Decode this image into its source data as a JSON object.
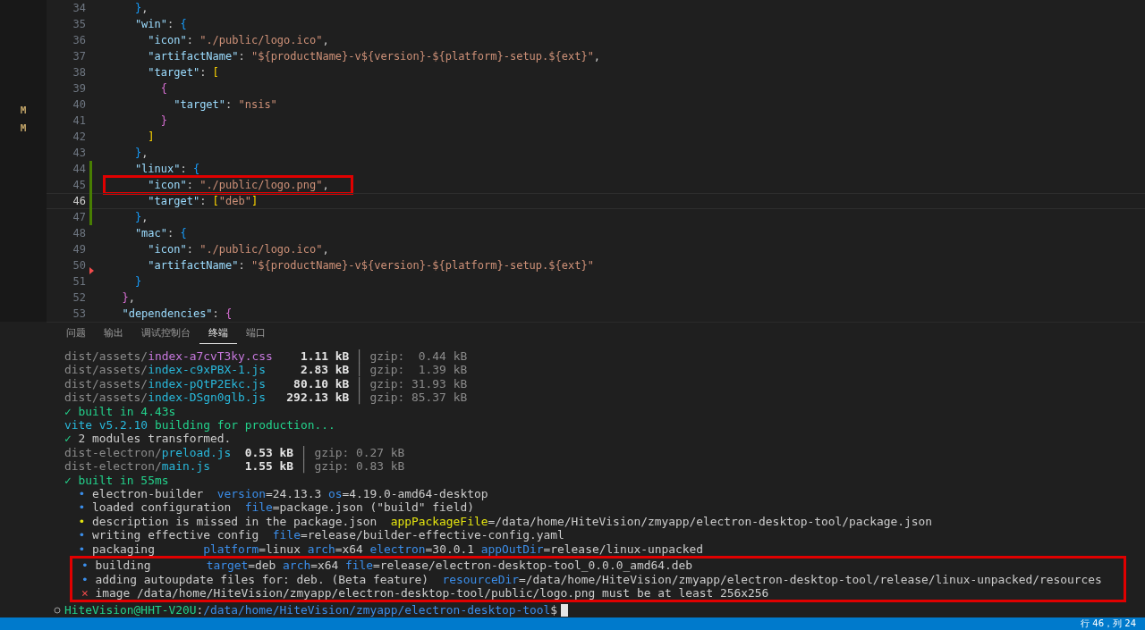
{
  "scm_markers": [
    "M",
    "M"
  ],
  "editor": {
    "lines": [
      {
        "number": "34",
        "tokens": [
          {
            "text": "    }",
            "kind": "b3"
          },
          {
            "text": ",",
            "kind": "p"
          }
        ]
      },
      {
        "number": "35",
        "tokens": [
          {
            "text": "    \"win\"",
            "kind": "key"
          },
          {
            "text": ": ",
            "kind": "p"
          },
          {
            "text": "{",
            "kind": "b3"
          }
        ]
      },
      {
        "number": "36",
        "tokens": [
          {
            "text": "      \"icon\"",
            "kind": "key"
          },
          {
            "text": ": ",
            "kind": "p"
          },
          {
            "text": "\"./public/logo.ico\"",
            "kind": "str"
          },
          {
            "text": ",",
            "kind": "p"
          }
        ]
      },
      {
        "number": "37",
        "tokens": [
          {
            "text": "      \"artifactName\"",
            "kind": "key"
          },
          {
            "text": ": ",
            "kind": "p"
          },
          {
            "text": "\"${productName}-v${version}-${platform}-setup.${ext}\"",
            "kind": "str"
          },
          {
            "text": ",",
            "kind": "p"
          }
        ]
      },
      {
        "number": "38",
        "tokens": [
          {
            "text": "      \"target\"",
            "kind": "key"
          },
          {
            "text": ": ",
            "kind": "p"
          },
          {
            "text": "[",
            "kind": "b1"
          }
        ]
      },
      {
        "number": "39",
        "tokens": [
          {
            "text": "        {",
            "kind": "b2"
          }
        ]
      },
      {
        "number": "40",
        "tokens": [
          {
            "text": "          \"target\"",
            "kind": "key"
          },
          {
            "text": ": ",
            "kind": "p"
          },
          {
            "text": "\"nsis\"",
            "kind": "str"
          }
        ]
      },
      {
        "number": "41",
        "tokens": [
          {
            "text": "        }",
            "kind": "b2"
          }
        ]
      },
      {
        "number": "42",
        "tokens": [
          {
            "text": "      ]",
            "kind": "b1"
          }
        ]
      },
      {
        "number": "43",
        "tokens": [
          {
            "text": "    }",
            "kind": "b3"
          },
          {
            "text": ",",
            "kind": "p"
          }
        ]
      },
      {
        "number": "44",
        "added": true,
        "tokens": [
          {
            "text": "    \"linux\"",
            "kind": "key"
          },
          {
            "text": ": ",
            "kind": "p"
          },
          {
            "text": "{",
            "kind": "b3"
          }
        ]
      },
      {
        "number": "45",
        "added": true,
        "boxed": true,
        "tokens": [
          {
            "text": "      \"icon\"",
            "kind": "key"
          },
          {
            "text": ": ",
            "kind": "p"
          },
          {
            "text": "\"./public/logo.png\"",
            "kind": "str"
          },
          {
            "text": ",",
            "kind": "p"
          }
        ]
      },
      {
        "number": "46",
        "added": true,
        "current": true,
        "tokens": [
          {
            "text": "      \"target\"",
            "kind": "key"
          },
          {
            "text": ": ",
            "kind": "p"
          },
          {
            "text": "[",
            "kind": "b1"
          },
          {
            "text": "\"deb\"",
            "kind": "str"
          },
          {
            "text": "]",
            "kind": "b1"
          }
        ]
      },
      {
        "number": "47",
        "added": true,
        "tokens": [
          {
            "text": "    }",
            "kind": "b3"
          },
          {
            "text": ",",
            "kind": "p"
          }
        ]
      },
      {
        "number": "48",
        "tokens": [
          {
            "text": "    \"mac\"",
            "kind": "key"
          },
          {
            "text": ": ",
            "kind": "p"
          },
          {
            "text": "{",
            "kind": "b3"
          }
        ]
      },
      {
        "number": "49",
        "tokens": [
          {
            "text": "      \"icon\"",
            "kind": "key"
          },
          {
            "text": ": ",
            "kind": "p"
          },
          {
            "text": "\"./public/logo.ico\"",
            "kind": "str"
          },
          {
            "text": ",",
            "kind": "p"
          }
        ]
      },
      {
        "number": "50",
        "deleted": true,
        "tokens": [
          {
            "text": "      \"artifactName\"",
            "kind": "key"
          },
          {
            "text": ": ",
            "kind": "p"
          },
          {
            "text": "\"${productName}-v${version}-${platform}-setup.${ext}\"",
            "kind": "str"
          }
        ]
      },
      {
        "number": "51",
        "tokens": [
          {
            "text": "    }",
            "kind": "b3"
          }
        ]
      },
      {
        "number": "52",
        "tokens": [
          {
            "text": "  }",
            "kind": "b2"
          },
          {
            "text": ",",
            "kind": "p"
          }
        ]
      },
      {
        "number": "53",
        "tokens": [
          {
            "text": "  \"dependencies\"",
            "kind": "key"
          },
          {
            "text": ": ",
            "kind": "p"
          },
          {
            "text": "{",
            "kind": "b2"
          }
        ]
      }
    ]
  },
  "panel": {
    "tabs": [
      {
        "label": "问题",
        "selected": false
      },
      {
        "label": "输出",
        "selected": false
      },
      {
        "label": "调试控制台",
        "selected": false
      },
      {
        "label": "终端",
        "selected": true
      },
      {
        "label": "端口",
        "selected": false
      }
    ],
    "terminal": [
      {
        "segs": [
          {
            "text": "dist/assets/",
            "kind": "dim"
          },
          {
            "text": "index-a7cvT3ky.css",
            "kind": "mag"
          },
          {
            "text": "    1.11 kB",
            "kind": "bold"
          },
          {
            "text": " │ ",
            "kind": "dim"
          },
          {
            "text": "gzip:  0.44 kB",
            "kind": "dim"
          }
        ]
      },
      {
        "segs": [
          {
            "text": "dist/assets/",
            "kind": "dim"
          },
          {
            "text": "index-c9xPBX-1.js",
            "kind": "cyan"
          },
          {
            "text": "     2.83 kB",
            "kind": "bold"
          },
          {
            "text": " │ ",
            "kind": "dim"
          },
          {
            "text": "gzip:  1.39 kB",
            "kind": "dim"
          }
        ]
      },
      {
        "segs": [
          {
            "text": "dist/assets/",
            "kind": "dim"
          },
          {
            "text": "index-pQtP2Ekc.js",
            "kind": "cyan"
          },
          {
            "text": "    80.10 kB",
            "kind": "bold"
          },
          {
            "text": " │ ",
            "kind": "dim"
          },
          {
            "text": "gzip: 31.93 kB",
            "kind": "dim"
          }
        ]
      },
      {
        "segs": [
          {
            "text": "dist/assets/",
            "kind": "dim"
          },
          {
            "text": "index-DSgn0glb.js",
            "kind": "cyan"
          },
          {
            "text": "   292.13 kB",
            "kind": "bold"
          },
          {
            "text": " │ ",
            "kind": "dim"
          },
          {
            "text": "gzip: 85.37 kB",
            "kind": "dim"
          }
        ]
      },
      {
        "segs": [
          {
            "text": "✓ built in 4.43s",
            "kind": "green"
          }
        ]
      },
      {
        "segs": [
          {
            "text": "vite v5.2.10 ",
            "kind": "cyan"
          },
          {
            "text": "building for production...",
            "kind": "green"
          }
        ]
      },
      {
        "segs": [
          {
            "text": "✓ ",
            "kind": "green"
          },
          {
            "text": "2 modules transformed.",
            "kind": "text"
          }
        ]
      },
      {
        "segs": [
          {
            "text": "dist-electron/",
            "kind": "dim"
          },
          {
            "text": "preload.js",
            "kind": "cyan"
          },
          {
            "text": "  0.53 kB",
            "kind": "bold"
          },
          {
            "text": " │ ",
            "kind": "dim"
          },
          {
            "text": "gzip: 0.27 kB",
            "kind": "dim"
          }
        ]
      },
      {
        "segs": [
          {
            "text": "dist-electron/",
            "kind": "dim"
          },
          {
            "text": "main.js",
            "kind": "cyan"
          },
          {
            "text": "     1.55 kB",
            "kind": "bold"
          },
          {
            "text": " │ ",
            "kind": "dim"
          },
          {
            "text": "gzip: 0.83 kB",
            "kind": "dim"
          }
        ]
      },
      {
        "segs": [
          {
            "text": "✓ built in 55ms",
            "kind": "green"
          }
        ]
      },
      {
        "segs": [
          {
            "text": "  • ",
            "kind": "blue"
          },
          {
            "text": "electron-builder  ",
            "kind": "text"
          },
          {
            "text": "version",
            "kind": "blue"
          },
          {
            "text": "=24.13.3 ",
            "kind": "text"
          },
          {
            "text": "os",
            "kind": "blue"
          },
          {
            "text": "=4.19.0-amd64-desktop",
            "kind": "text"
          }
        ]
      },
      {
        "segs": [
          {
            "text": "  • ",
            "kind": "blue"
          },
          {
            "text": "loaded configuration  ",
            "kind": "text"
          },
          {
            "text": "file",
            "kind": "blue"
          },
          {
            "text": "=package.json (\"build\" field)",
            "kind": "text"
          }
        ]
      },
      {
        "segs": [
          {
            "text": "  • ",
            "kind": "yellow"
          },
          {
            "text": "description is missed in the package.json  ",
            "kind": "text"
          },
          {
            "text": "appPackageFile",
            "kind": "yellow"
          },
          {
            "text": "=/data/home/HiteVision/zmyapp/electron-desktop-tool/package.json",
            "kind": "text"
          }
        ]
      },
      {
        "segs": [
          {
            "text": "  • ",
            "kind": "blue"
          },
          {
            "text": "writing effective config  ",
            "kind": "text"
          },
          {
            "text": "file",
            "kind": "blue"
          },
          {
            "text": "=release/builder-effective-config.yaml",
            "kind": "text"
          }
        ]
      },
      {
        "segs": [
          {
            "text": "  • ",
            "kind": "blue"
          },
          {
            "text": "packaging       ",
            "kind": "text"
          },
          {
            "text": "platform",
            "kind": "blue"
          },
          {
            "text": "=linux ",
            "kind": "text"
          },
          {
            "text": "arch",
            "kind": "blue"
          },
          {
            "text": "=x64 ",
            "kind": "text"
          },
          {
            "text": "electron",
            "kind": "blue"
          },
          {
            "text": "=30.0.1 ",
            "kind": "text"
          },
          {
            "text": "appOutDir",
            "kind": "blue"
          },
          {
            "text": "=release/linux-unpacked",
            "kind": "text"
          }
        ]
      },
      {
        "boxed": true,
        "segs": [
          {
            "text": "• ",
            "kind": "blue"
          },
          {
            "text": "building        ",
            "kind": "text"
          },
          {
            "text": "target",
            "kind": "blue"
          },
          {
            "text": "=deb ",
            "kind": "text"
          },
          {
            "text": "arch",
            "kind": "blue"
          },
          {
            "text": "=x64 ",
            "kind": "text"
          },
          {
            "text": "file",
            "kind": "blue"
          },
          {
            "text": "=release/electron-desktop-tool_0.0.0_amd64.deb",
            "kind": "text"
          }
        ]
      },
      {
        "boxed": true,
        "segs": [
          {
            "text": "• ",
            "kind": "blue"
          },
          {
            "text": "adding autoupdate files for: deb. (Beta feature)  ",
            "kind": "text"
          },
          {
            "text": "resourceDir",
            "kind": "blue"
          },
          {
            "text": "=/data/home/HiteVision/zmyapp/electron-desktop-tool/release/linux-unpacked/resources",
            "kind": "text"
          }
        ]
      },
      {
        "boxed": true,
        "segs": [
          {
            "text": "⨯ ",
            "kind": "red"
          },
          {
            "text": "image /data/home/HiteVision/zmyapp/electron-desktop-tool/public/logo.png must be at least 256x256",
            "kind": "text"
          }
        ]
      }
    ],
    "prompt": {
      "user": "HiteVision@HHT-V20U",
      "sep": ":",
      "path": "/data/home/HiteVision/zmyapp/electron-desktop-tool",
      "symbol": "$"
    }
  },
  "status_bar": {
    "position": "行 46，列 24"
  }
}
